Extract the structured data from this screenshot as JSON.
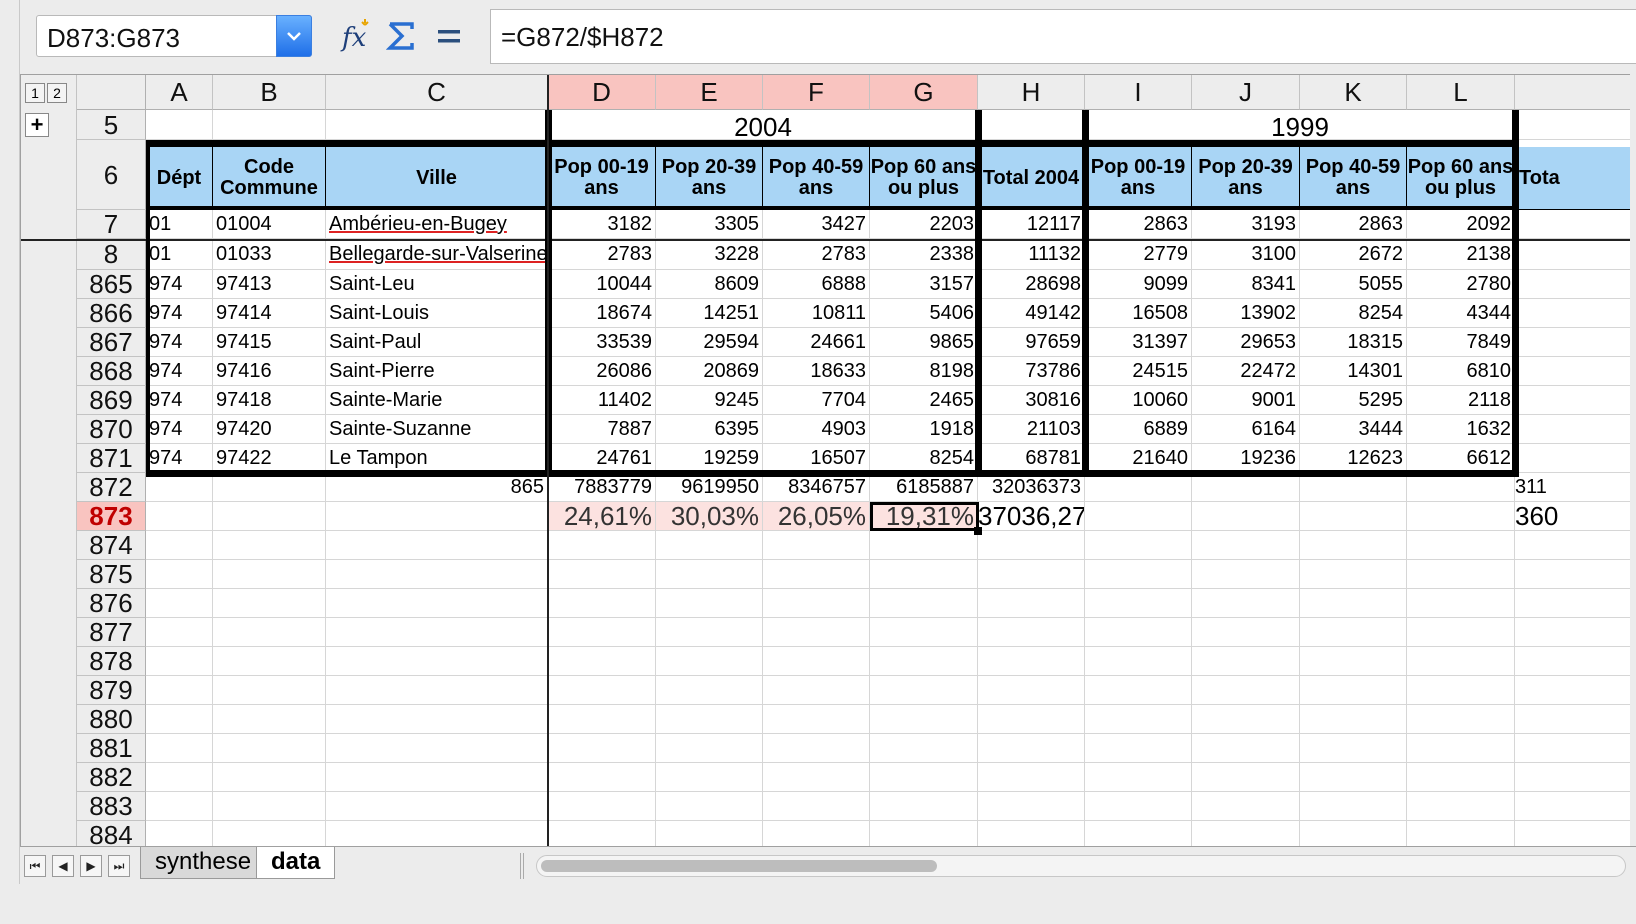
{
  "formula_bar": {
    "name_box": "D873:G873",
    "formula": "=G872/$H872"
  },
  "outline": {
    "level1": "1",
    "level2": "2",
    "expand": "+"
  },
  "columns": [
    "A",
    "B",
    "C",
    "D",
    "E",
    "F",
    "G",
    "H",
    "I",
    "J",
    "K",
    "L",
    ""
  ],
  "selected_columns": [
    "D",
    "E",
    "F",
    "G"
  ],
  "group_headers": {
    "y2004": "2004",
    "y1999": "1999"
  },
  "table_headers": {
    "dept": "Dépt",
    "code": "Code Commune",
    "ville": "Ville",
    "p0019": "Pop 00-19 ans",
    "p2039": "Pop 20-39 ans",
    "p4059": "Pop 40-59 ans",
    "p60": "Pop 60 ans ou plus",
    "total2004": "Total 2004",
    "p0019b": "Pop 00-19 ans",
    "p2039b": "Pop 20-39 ans",
    "p4059b": "Pop 40-59 ans",
    "p60b": "Pop 60 ans ou plus",
    "totalb": "Tota"
  },
  "rows": [
    {
      "num": "7",
      "a": "01",
      "b": "01004",
      "c": "Ambérieu-en-Bugey",
      "d": "3182",
      "e": "3305",
      "f": "3427",
      "g": "2203",
      "h": "12117",
      "i": "2863",
      "j": "3193",
      "k": "2863",
      "l": "2092"
    },
    {
      "num": "8",
      "a": "01",
      "b": "01033",
      "c": "Bellegarde-sur-Valserine",
      "d": "2783",
      "e": "3228",
      "f": "2783",
      "g": "2338",
      "h": "11132",
      "i": "2779",
      "j": "3100",
      "k": "2672",
      "l": "2138"
    },
    {
      "num": "865",
      "a": "974",
      "b": "97413",
      "c": "Saint-Leu",
      "d": "10044",
      "e": "8609",
      "f": "6888",
      "g": "3157",
      "h": "28698",
      "i": "9099",
      "j": "8341",
      "k": "5055",
      "l": "2780"
    },
    {
      "num": "866",
      "a": "974",
      "b": "97414",
      "c": "Saint-Louis",
      "d": "18674",
      "e": "14251",
      "f": "10811",
      "g": "5406",
      "h": "49142",
      "i": "16508",
      "j": "13902",
      "k": "8254",
      "l": "4344"
    },
    {
      "num": "867",
      "a": "974",
      "b": "97415",
      "c": "Saint-Paul",
      "d": "33539",
      "e": "29594",
      "f": "24661",
      "g": "9865",
      "h": "97659",
      "i": "31397",
      "j": "29653",
      "k": "18315",
      "l": "7849"
    },
    {
      "num": "868",
      "a": "974",
      "b": "97416",
      "c": "Saint-Pierre",
      "d": "26086",
      "e": "20869",
      "f": "18633",
      "g": "8198",
      "h": "73786",
      "i": "24515",
      "j": "22472",
      "k": "14301",
      "l": "6810"
    },
    {
      "num": "869",
      "a": "974",
      "b": "97418",
      "c": "Sainte-Marie",
      "d": "11402",
      "e": "9245",
      "f": "7704",
      "g": "2465",
      "h": "30816",
      "i": "10060",
      "j": "9001",
      "k": "5295",
      "l": "2118"
    },
    {
      "num": "870",
      "a": "974",
      "b": "97420",
      "c": "Sainte-Suzanne",
      "d": "7887",
      "e": "6395",
      "f": "4903",
      "g": "1918",
      "h": "21103",
      "i": "6889",
      "j": "6164",
      "k": "3444",
      "l": "1632"
    },
    {
      "num": "871",
      "a": "974",
      "b": "97422",
      "c": "Le Tampon",
      "d": "24761",
      "e": "19259",
      "f": "16507",
      "g": "8254",
      "h": "68781",
      "i": "21640",
      "j": "19236",
      "k": "12623",
      "l": "6612"
    }
  ],
  "totals_row": {
    "num": "872",
    "c": "865",
    "d": "7883779",
    "e": "9619950",
    "f": "8346757",
    "g": "6185887",
    "h": "32036373",
    "m": "311"
  },
  "pct_row": {
    "num": "873",
    "d": "24,61%",
    "e": "30,03%",
    "f": "26,05%",
    "g": "19,31%",
    "h": "37036,27",
    "m": "360"
  },
  "empty_rows": [
    "874",
    "875",
    "876",
    "877",
    "878",
    "879",
    "880",
    "881",
    "882",
    "883",
    "884"
  ],
  "header_row_nums": {
    "r5": "5",
    "r6": "6"
  },
  "sheet_tabs": {
    "synthese": "synthese",
    "data": "data"
  },
  "nav": {
    "first": "⏮",
    "prev": "◀",
    "next": "▶",
    "last": "⏭"
  },
  "colors": {
    "header_blue": "#a9d5f5",
    "selection_pink": "#f9c4c0"
  }
}
